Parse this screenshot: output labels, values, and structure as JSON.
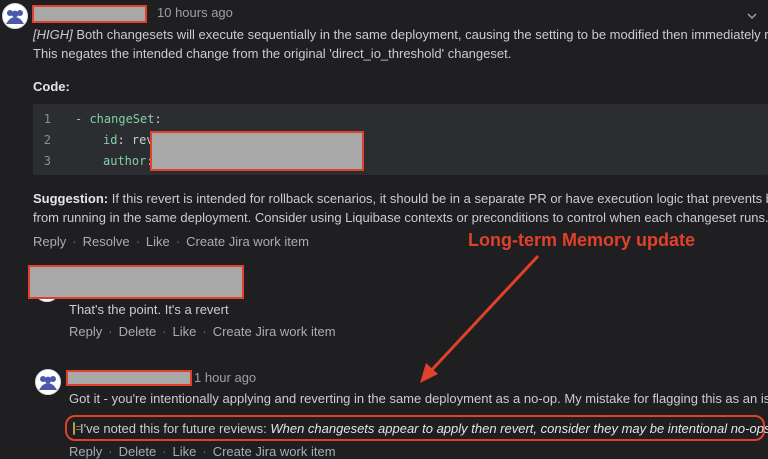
{
  "comment1": {
    "timestamp": "10 hours ago",
    "severity_tag": "[HIGH]",
    "body_line1": " Both changesets will execute sequentially in the same deployment, causing the setting to be modified then immediately reset.",
    "body_line2": "This negates the intended change from the original 'direct_io_threshold' changeset.",
    "code_heading": "Code:",
    "code_lines": [
      {
        "num": "1",
        "key": "- changeSet",
        "rest": ":"
      },
      {
        "num": "2",
        "key": "id",
        "rest": ": reve"
      },
      {
        "num": "3",
        "key": "author",
        "rest": ":"
      }
    ],
    "suggestion_label": "Suggestion:",
    "suggestion_line1": " If this revert is intended for rollback scenarios, it should be in a separate PR or have execution logic that prevents both",
    "suggestion_line2": "from running in the same deployment. Consider using Liquibase contexts or preconditions to control when each changeset runs.",
    "actions": [
      "Reply",
      "Resolve",
      "Like",
      "Create Jira work item"
    ]
  },
  "annotation": {
    "label": "Long-term Memory update",
    "color": "#e0412a"
  },
  "comment2": {
    "body": "That's the point. It's a revert",
    "actions": [
      "Reply",
      "Delete",
      "Like",
      "Create Jira work item"
    ]
  },
  "comment3": {
    "timestamp": "1 hour ago",
    "body": "Got it - you're intentionally applying and reverting in the same deployment as a no-op. My mistake for flagging this as an issue.",
    "memo_icon": "memo-icon",
    "memo_prefix": "I've noted this for future reviews: ",
    "memo_italic": "When changesets appear to apply then revert, consider they may be intentional no-ops.",
    "actions": [
      "Reply",
      "Delete",
      "Like",
      "Create Jira work item"
    ]
  },
  "colors": {
    "background": "#1f1f21",
    "code_background": "#2c2d31",
    "keyword": "#7fd1a4",
    "highlight": "#e0412a"
  }
}
